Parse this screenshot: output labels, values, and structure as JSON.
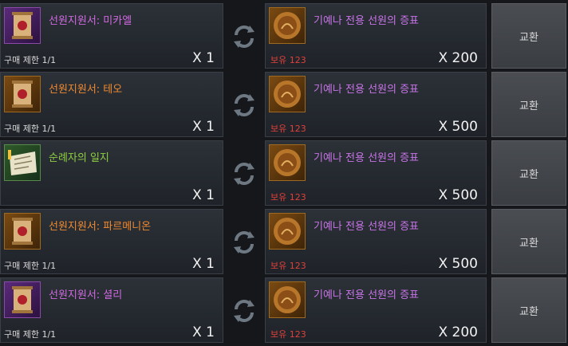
{
  "exchange_button_label": "교환",
  "owned_label": "보유 123",
  "rows": [
    {
      "item_name": "선원지원서: 미카엘",
      "name_color": "#d06ae0",
      "icon": "scroll-icon",
      "limit": "구매 제한 1/1",
      "qty": "X 1",
      "cost_name": "기예나 전용 선원의 증표",
      "cost_qty": "X 200"
    },
    {
      "item_name": "선원지원서: 테오",
      "name_color": "#f08a30",
      "icon": "scroll-icon",
      "limit": "구매 제한 1/1",
      "qty": "X 1",
      "cost_name": "기예나 전용 선원의 증표",
      "cost_qty": "X 500"
    },
    {
      "item_name": "순례자의 일지",
      "name_color": "#8fd040",
      "icon": "journal-icon",
      "limit": "",
      "qty": "X 1",
      "cost_name": "기예나 전용 선원의 증표",
      "cost_qty": "X 500"
    },
    {
      "item_name": "선원지원서: 파르메니온",
      "name_color": "#f08a30",
      "icon": "scroll-icon",
      "limit": "구매 제한 1/1",
      "qty": "X 1",
      "cost_name": "기예나 전용 선원의 증표",
      "cost_qty": "X 500"
    },
    {
      "item_name": "선원지원서: 셜리",
      "name_color": "#d06ae0",
      "icon": "scroll-icon",
      "limit": "구매 제한 1/1",
      "qty": "X 1",
      "cost_name": "기예나 전용 선원의 증표",
      "cost_qty": "X 200"
    }
  ],
  "colors": {
    "cost_name": "#c874e8",
    "owned": "#e0403a"
  }
}
